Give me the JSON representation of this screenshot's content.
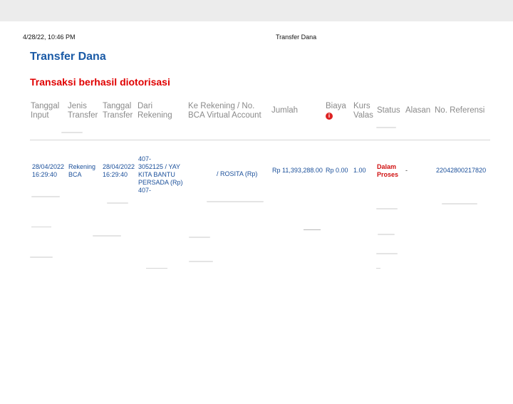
{
  "print_header": {
    "datetime": "4/28/22, 10:46 PM",
    "page_title": "Transfer Dana"
  },
  "title": "Transfer Dana",
  "message": "Transaksi berhasil diotorisasi",
  "table": {
    "headers": {
      "tanggal_input": [
        "Tanggal",
        "Input"
      ],
      "jenis_transfer": [
        "Jenis",
        "Transfer"
      ],
      "tanggal_transfer": [
        "Tanggal",
        "Transfer"
      ],
      "dari_rekening": [
        "Dari",
        "Rekening"
      ],
      "ke_rekening": [
        "Ke Rekening / No.",
        "BCA Virtual Account"
      ],
      "jumlah": "Jumlah",
      "biaya": "Biaya",
      "kurs": [
        "Kurs",
        "Valas"
      ],
      "status": "Status",
      "alasan": "Alasan",
      "no_referensi": "No. Referensi"
    },
    "row": {
      "tanggal_input": [
        "28/04/2022",
        "16:29:40"
      ],
      "jenis_transfer": [
        "Rekening",
        "BCA"
      ],
      "tanggal_transfer": [
        "28/04/2022",
        "16:29:40"
      ],
      "dari_rekening": [
        "407-",
        "3052125 / YAY",
        "KITA BANTU",
        "PERSADA (Rp)",
        "407-"
      ],
      "ke_rekening": "/ ROSITA (Rp)",
      "jumlah": "Rp 11,393,288.00",
      "biaya": "Rp 0.00",
      "kurs": "1.00",
      "status": [
        "Dalam",
        "Proses"
      ],
      "alasan": "-",
      "no_referensi": "22042800217820"
    }
  },
  "icons": {
    "biaya_info": "info-icon"
  },
  "colors": {
    "title": "#1a5aa6",
    "message": "#e00000",
    "cell_text": "#1a4f9a",
    "status": "#d01010"
  }
}
